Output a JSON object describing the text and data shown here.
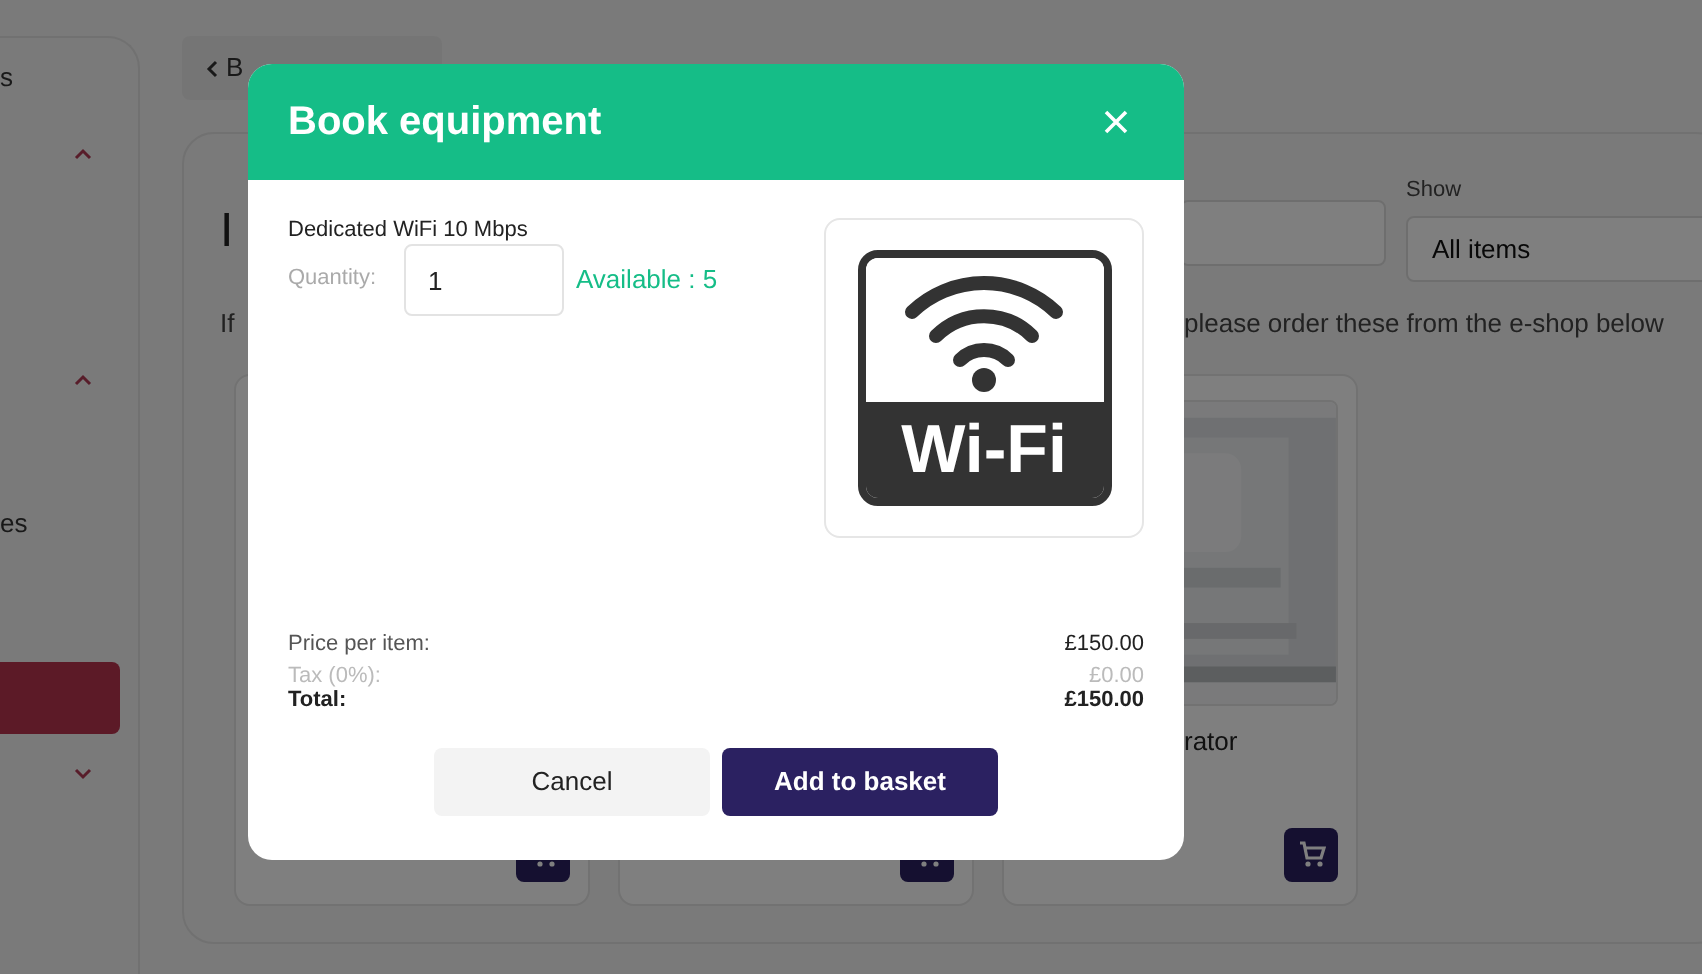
{
  "sidebar": {
    "items": [
      {
        "kind": "label",
        "label": "s"
      },
      {
        "kind": "group",
        "expanded": true
      },
      {
        "kind": "group",
        "expanded": true
      },
      {
        "kind": "label",
        "label": "es"
      },
      {
        "kind": "link",
        "selected": true
      },
      {
        "kind": "group",
        "expanded": false
      }
    ]
  },
  "back_link": {
    "label": "B"
  },
  "page": {
    "heading": "I",
    "intro_start": "If",
    "intro_end": "please order these from the e-shop below",
    "show": {
      "label": "Show",
      "value": "All items"
    }
  },
  "products": [
    {
      "cart": true
    },
    {
      "cart": true
    },
    {
      "title": "rator",
      "cart": true
    }
  ],
  "dialog": {
    "title": "Book equipment",
    "item_name": "Dedicated WiFi 10 Mbps",
    "quantity": {
      "label": "Quantity:",
      "value": "1"
    },
    "availability": "Available : 5",
    "image_label": "Wi-Fi",
    "summary": [
      {
        "kind": "normal",
        "label": "Price per item:",
        "value": "£150.00"
      },
      {
        "kind": "muted",
        "label": "Tax (0%):",
        "value": "£0.00"
      },
      {
        "kind": "total",
        "label": "Total:",
        "value": "£150.00"
      }
    ],
    "buttons": [
      {
        "kind": "secondary",
        "label": "Cancel"
      },
      {
        "kind": "primary",
        "label": "Add to basket"
      }
    ]
  }
}
